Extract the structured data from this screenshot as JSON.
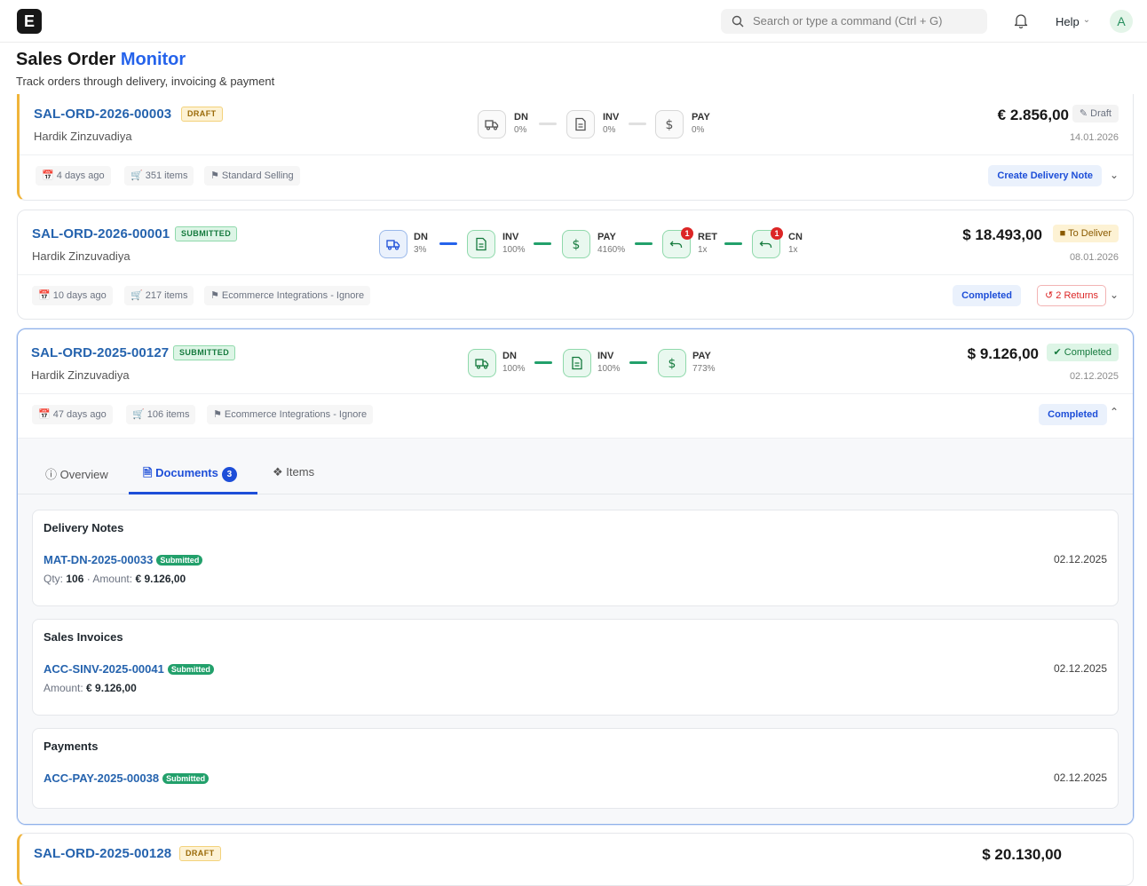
{
  "topbar": {
    "logo": "E",
    "search_placeholder": "Search or type a command (Ctrl + G)",
    "help": "Help",
    "avatar": "A"
  },
  "page": {
    "title_main": "Sales Order",
    "title_accent": "Monitor",
    "subtitle": "Track orders through delivery, invoicing & payment"
  },
  "orders": [
    {
      "id": "SAL-ORD-2026-00003",
      "status": "DRAFT",
      "customer": "Hardik Zinzuvadiya",
      "amount": "€ 2.856,00",
      "state": "Draft",
      "date": "14.01.2026",
      "age": "4 days ago",
      "items": "351 items",
      "type": "Standard Selling",
      "action": "Create Delivery Note",
      "steps": [
        {
          "label": "DN",
          "pct": "0%"
        },
        {
          "label": "INV",
          "pct": "0%"
        },
        {
          "label": "PAY",
          "pct": "0%"
        }
      ]
    },
    {
      "id": "SAL-ORD-2026-00001",
      "status": "SUBMITTED",
      "customer": "Hardik Zinzuvadiya",
      "amount": "$ 18.493,00",
      "state": "To Deliver",
      "date": "08.01.2026",
      "age": "10 days ago",
      "items": "217 items",
      "type": "Ecommerce Integrations - Ignore",
      "action": "Completed",
      "returns": "2 Returns",
      "steps": [
        {
          "label": "DN",
          "pct": "3%"
        },
        {
          "label": "INV",
          "pct": "100%"
        },
        {
          "label": "PAY",
          "pct": "4160%"
        },
        {
          "label": "RET",
          "pct": "1x",
          "count": "1"
        },
        {
          "label": "CN",
          "pct": "1x",
          "count": "1"
        }
      ]
    },
    {
      "id": "SAL-ORD-2025-00127",
      "status": "SUBMITTED",
      "customer": "Hardik Zinzuvadiya",
      "amount": "$ 9.126,00",
      "state": "Completed",
      "date": "02.12.2025",
      "age": "47 days ago",
      "items": "106 items",
      "type": "Ecommerce Integrations - Ignore",
      "action": "Completed",
      "steps": [
        {
          "label": "DN",
          "pct": "100%"
        },
        {
          "label": "INV",
          "pct": "100%"
        },
        {
          "label": "PAY",
          "pct": "773%"
        }
      ],
      "tabs": {
        "overview": "Overview",
        "documents": "Documents",
        "documents_count": "3",
        "items": "Items"
      },
      "documents": {
        "delivery": {
          "title": "Delivery Notes",
          "id": "MAT-DN-2025-00033",
          "status": "Submitted",
          "qty_label": "Qty:",
          "qty": "106",
          "amount_label": "Amount:",
          "amount": "€ 9.126,00",
          "date": "02.12.2025"
        },
        "invoice": {
          "title": "Sales Invoices",
          "id": "ACC-SINV-2025-00041",
          "status": "Submitted",
          "amount_label": "Amount:",
          "amount": "€ 9.126,00",
          "date": "02.12.2025"
        },
        "payment": {
          "title": "Payments",
          "id": "ACC-PAY-2025-00038",
          "status": "Submitted",
          "date": "02.12.2025"
        }
      }
    },
    {
      "id": "SAL-ORD-2025-00128",
      "status": "DRAFT",
      "amount": "$ 20.130,00"
    }
  ]
}
